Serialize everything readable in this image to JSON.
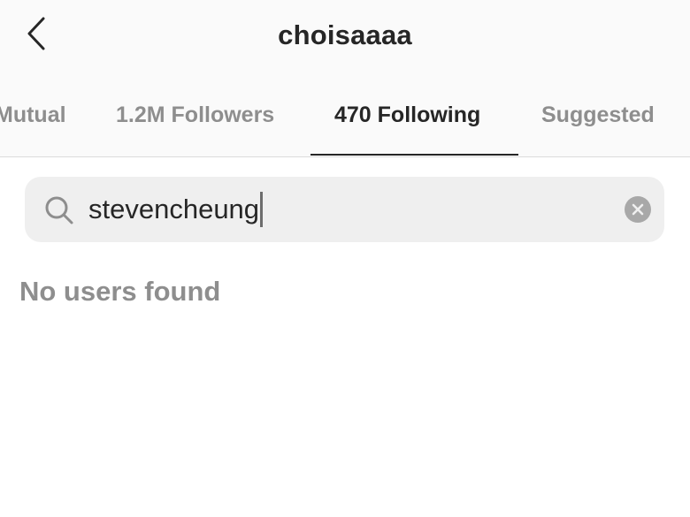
{
  "header": {
    "back_icon": "chevron-left-icon",
    "title": "choisaaaa"
  },
  "tabs": [
    {
      "label": "Mutual",
      "active": false
    },
    {
      "label": "1.2M Followers",
      "active": false
    },
    {
      "label": "470 Following",
      "active": true
    },
    {
      "label": "Suggested",
      "active": false
    }
  ],
  "search": {
    "icon": "search-icon",
    "value": "stevencheung",
    "clear_icon": "clear-icon"
  },
  "results": {
    "empty_message": "No users found"
  },
  "colors": {
    "primary_text": "#262626",
    "secondary_text": "#8e8e8e",
    "search_bg": "#efefef",
    "header_bg": "#fafafa"
  }
}
